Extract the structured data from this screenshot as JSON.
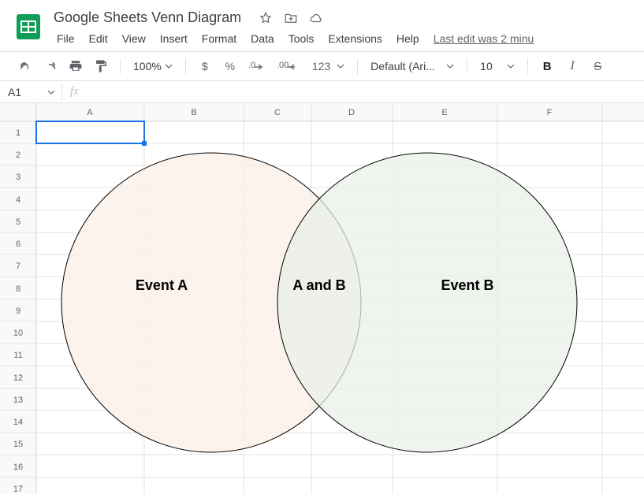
{
  "doc": {
    "title": "Google Sheets Venn Diagram"
  },
  "menu": {
    "file": "File",
    "edit": "Edit",
    "view": "View",
    "insert": "Insert",
    "format": "Format",
    "data": "Data",
    "tools": "Tools",
    "extensions": "Extensions",
    "help": "Help",
    "last_edit": "Last edit was 2 minu"
  },
  "toolbar": {
    "zoom": "100%",
    "currency": "$",
    "percent": "%",
    "dec_dec": ".0",
    "inc_dec": ".00",
    "num_format": "123",
    "font": "Default (Ari...",
    "font_size": "10",
    "bold": "B",
    "italic": "I",
    "strike": "S"
  },
  "formula": {
    "cell_ref": "A1",
    "fx": "fx",
    "value": ""
  },
  "grid": {
    "cols": [
      "A",
      "B",
      "C",
      "D",
      "E",
      "F"
    ],
    "rows": [
      "1",
      "2",
      "3",
      "4",
      "5",
      "6",
      "7",
      "8",
      "9",
      "10",
      "11",
      "12",
      "13",
      "14",
      "15",
      "16",
      "17"
    ]
  },
  "chart_data": {
    "type": "venn",
    "sets": [
      {
        "name": "Event A",
        "color": "#f6e8dc"
      },
      {
        "name": "Event B",
        "color": "#e4ede2"
      }
    ],
    "intersection_label": "A and B"
  }
}
